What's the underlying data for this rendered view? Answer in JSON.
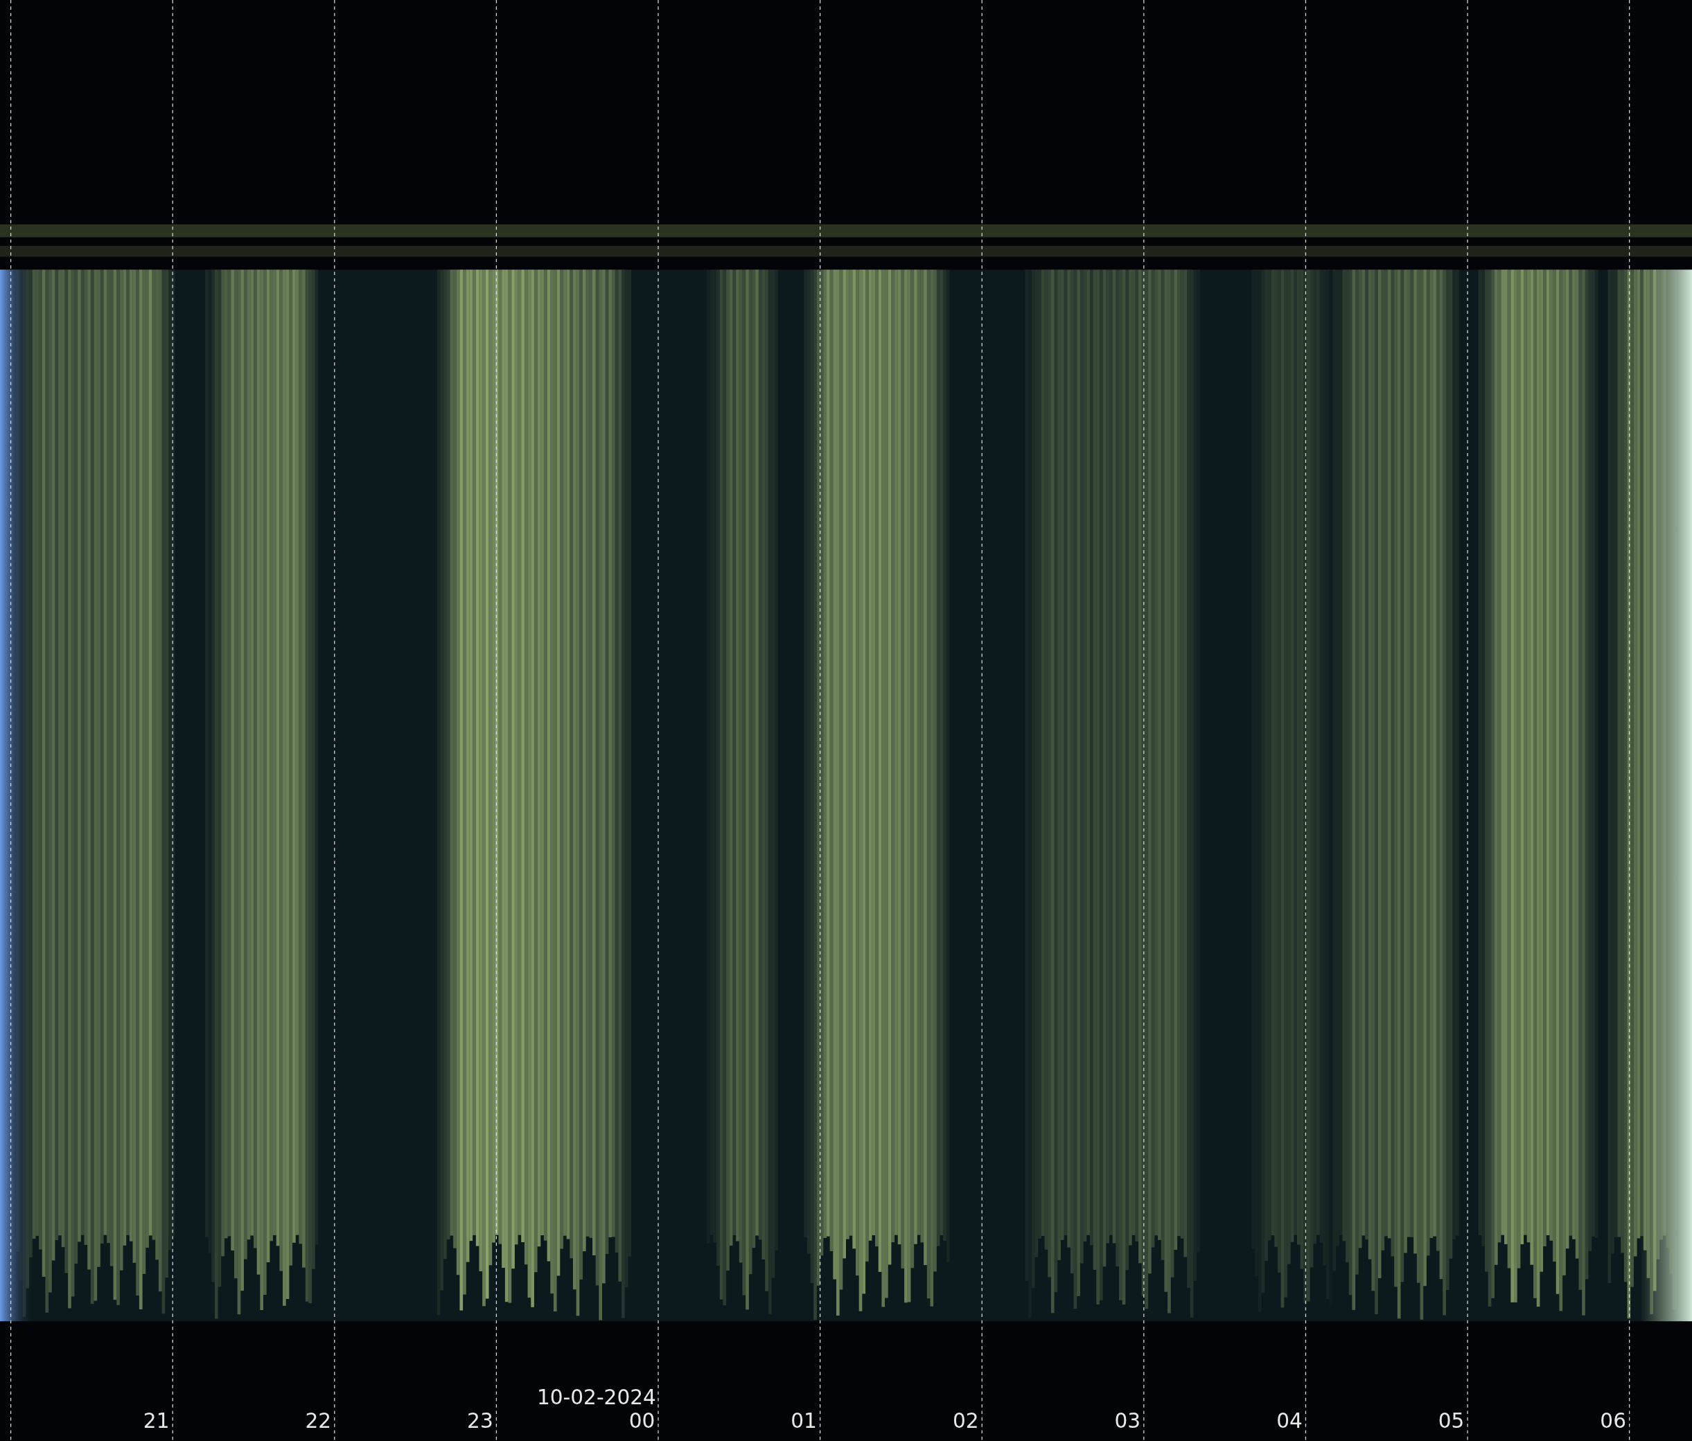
{
  "time_axis": {
    "date": "10-02-2024",
    "hours": [
      "21",
      "22",
      "23",
      "00",
      "01",
      "02",
      "03",
      "04",
      "05",
      "06"
    ]
  }
}
